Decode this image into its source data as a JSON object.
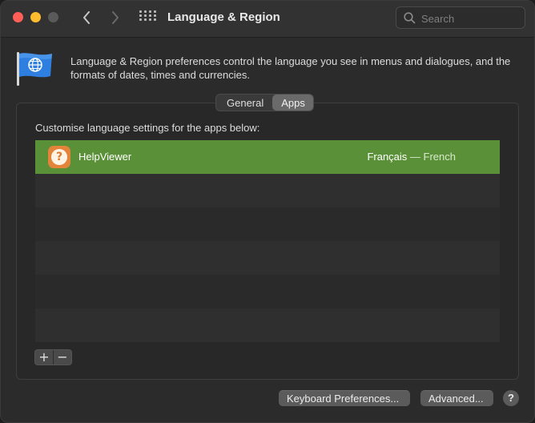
{
  "window": {
    "title": "Language & Region"
  },
  "toolbar": {
    "search_placeholder": "Search"
  },
  "header": {
    "description": "Language & Region preferences control the language you see in menus and dialogues, and the formats of dates, times and currencies."
  },
  "tabs": [
    {
      "label": "General",
      "selected": false
    },
    {
      "label": "Apps",
      "selected": true
    }
  ],
  "apps": {
    "caption": "Customise language settings for the apps below:",
    "rows": [
      {
        "name": "HelpViewer",
        "language_native": "Français",
        "language_sep": " — ",
        "language_english": "French",
        "selected": true
      }
    ],
    "add_symbol": "+",
    "remove_symbol": "−"
  },
  "footer": {
    "keyboard_label": "Keyboard Preferences...",
    "advanced_label": "Advanced...",
    "help_symbol": "?"
  },
  "colors": {
    "selection": "#5a9138",
    "close": "#ff5f57",
    "minimize": "#febc2e",
    "app_icon": "#e4843a"
  },
  "icons": {
    "back": "chevron-left-icon",
    "forward": "chevron-right-icon",
    "grid": "grid-icon",
    "search": "search-icon",
    "pane": "globe-flag-icon",
    "app": "help-viewer-icon"
  }
}
